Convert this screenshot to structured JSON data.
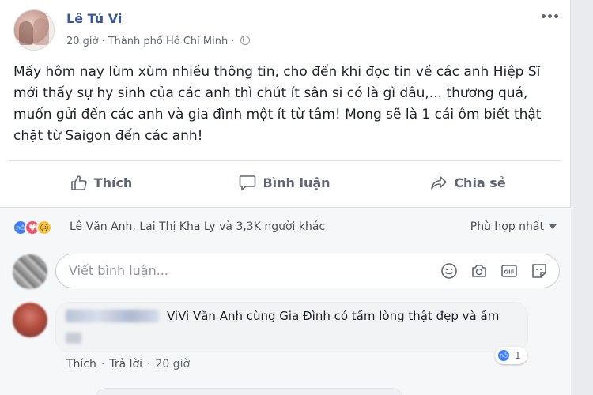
{
  "post": {
    "author": "Lê Tú Vi",
    "time": "20 giờ",
    "separator": "·",
    "location": "Thành phố Hồ Chí Minh",
    "text": "Mấy hôm nay lùm xùm nhiều thông tin, cho đến khi đọc tin về các anh Hiệp Sĩ mới thấy sự hy sinh của các anh thì chút ít sân si có là gì đâu,... thương quá, muốn gửi đến các anh và gia đình một ít từ tâm! Mong sẽ là 1 cái ôm biết thật chặt từ Saigon đến các anh!"
  },
  "actions": {
    "like_label": "Thích",
    "comment_label": "Bình luận",
    "share_label": "Chia sẻ"
  },
  "reactions": {
    "summary": "Lê Văn Anh, Lại Thị Kha Ly và 3,3K người khác",
    "sort_label": "Phù hợp nhất"
  },
  "comment_box": {
    "placeholder": "Viết bình luận..."
  },
  "comments": [
    {
      "text": "ViVi Văn Anh cùng Gia Đình có tấm lòng thật đẹp và ấm",
      "like_count": "1",
      "like_action": "Thích",
      "reply_action": "Trả lời",
      "dot": "·",
      "time": "20 giờ"
    }
  ],
  "colors": {
    "link_blue": "#385898",
    "like_blue": "#4080ff",
    "love_red": "#f25268",
    "sad_yellow": "#f5c33b"
  }
}
